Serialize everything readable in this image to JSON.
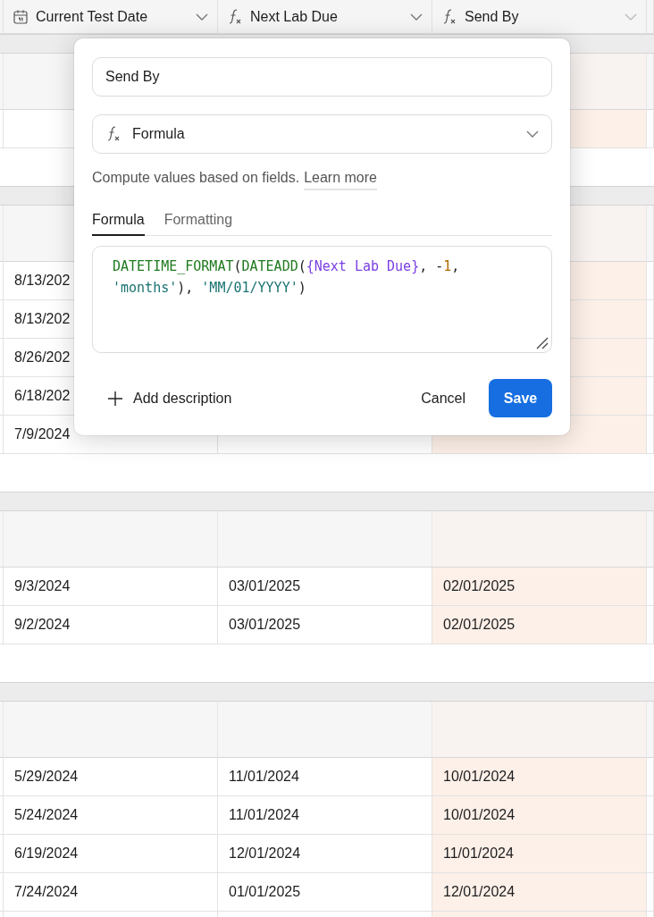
{
  "columns": [
    {
      "label": "Current Test Date"
    },
    {
      "label": "Next Lab Due"
    },
    {
      "label": "Send By"
    }
  ],
  "groups": [
    {
      "rows": [
        {}
      ]
    },
    {
      "rows": [
        {
          "current_test_date": "8/13/202"
        },
        {
          "current_test_date": "8/13/202"
        },
        {
          "current_test_date": "8/26/202"
        },
        {
          "current_test_date": "6/18/202"
        },
        {
          "current_test_date": "7/9/2024"
        }
      ]
    },
    {
      "rows": [
        {
          "current_test_date": "9/3/2024",
          "next_lab_due": "03/01/2025",
          "send_by": "02/01/2025"
        },
        {
          "current_test_date": "9/2/2024",
          "next_lab_due": "03/01/2025",
          "send_by": "02/01/2025"
        }
      ]
    },
    {
      "rows": [
        {
          "current_test_date": "5/29/2024",
          "next_lab_due": "11/01/2024",
          "send_by": "10/01/2024"
        },
        {
          "current_test_date": "5/24/2024",
          "next_lab_due": "11/01/2024",
          "send_by": "10/01/2024"
        },
        {
          "current_test_date": "6/19/2024",
          "next_lab_due": "12/01/2024",
          "send_by": "11/01/2024"
        },
        {
          "current_test_date": "7/24/2024",
          "next_lab_due": "01/01/2025",
          "send_by": "12/01/2024"
        },
        {}
      ]
    }
  ],
  "field_editor": {
    "name": "Send By",
    "field_type": "Formula",
    "description": "Compute values based on fields.",
    "learn_more": "Learn more",
    "tabs": [
      {
        "label": "Formula",
        "selected": true
      },
      {
        "label": "Formatting",
        "selected": false
      }
    ],
    "formula_lines": [
      [
        {
          "kind": "function",
          "text": "DATETIME_FORMAT"
        },
        {
          "kind": "punct",
          "text": "("
        },
        {
          "kind": "function",
          "text": "DATEADD"
        },
        {
          "kind": "punct",
          "text": "("
        },
        {
          "kind": "field",
          "text": "{Next Lab Due}"
        },
        {
          "kind": "punct",
          "text": ", -"
        },
        {
          "kind": "number",
          "text": "1"
        },
        {
          "kind": "punct",
          "text": ","
        }
      ],
      [
        {
          "kind": "string",
          "text": "'months'"
        },
        {
          "kind": "punct",
          "text": "), "
        },
        {
          "kind": "string",
          "text": "'MM/01/YYYY'"
        },
        {
          "kind": "punct",
          "text": ")"
        }
      ]
    ],
    "add_description": "Add description",
    "cancel": "Cancel",
    "save": "Save"
  }
}
